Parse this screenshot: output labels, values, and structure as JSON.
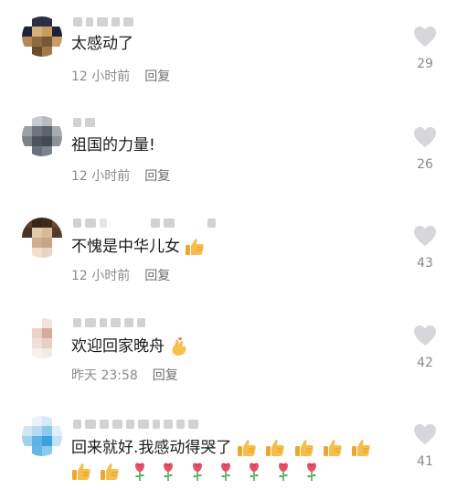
{
  "comments": [
    {
      "text": "太感动了",
      "time": "12 小时前",
      "reply": "回复",
      "likes": "29"
    },
    {
      "text": "祖国的力量!",
      "time": "12 小时前",
      "reply": "回复",
      "likes": "26"
    },
    {
      "text": "不愧是中华儿女",
      "time": "12 小时前",
      "reply": "回复",
      "likes": "43"
    },
    {
      "text": "欢迎回家晚舟",
      "time": "昨天 23:58",
      "reply": "回复",
      "likes": "42"
    },
    {
      "text": "回来就好.我感动得哭了",
      "likes": "41"
    }
  ],
  "icons": [
    "heart-icon",
    "thumbs-up-emoji",
    "finger-heart-emoji",
    "rose-emoji"
  ],
  "colors": {
    "text": "#1b1b1f",
    "meta": "#8a8a90",
    "heart": "#d7d7db",
    "emoji": "#f4b23a",
    "rose": "#e8506a"
  }
}
